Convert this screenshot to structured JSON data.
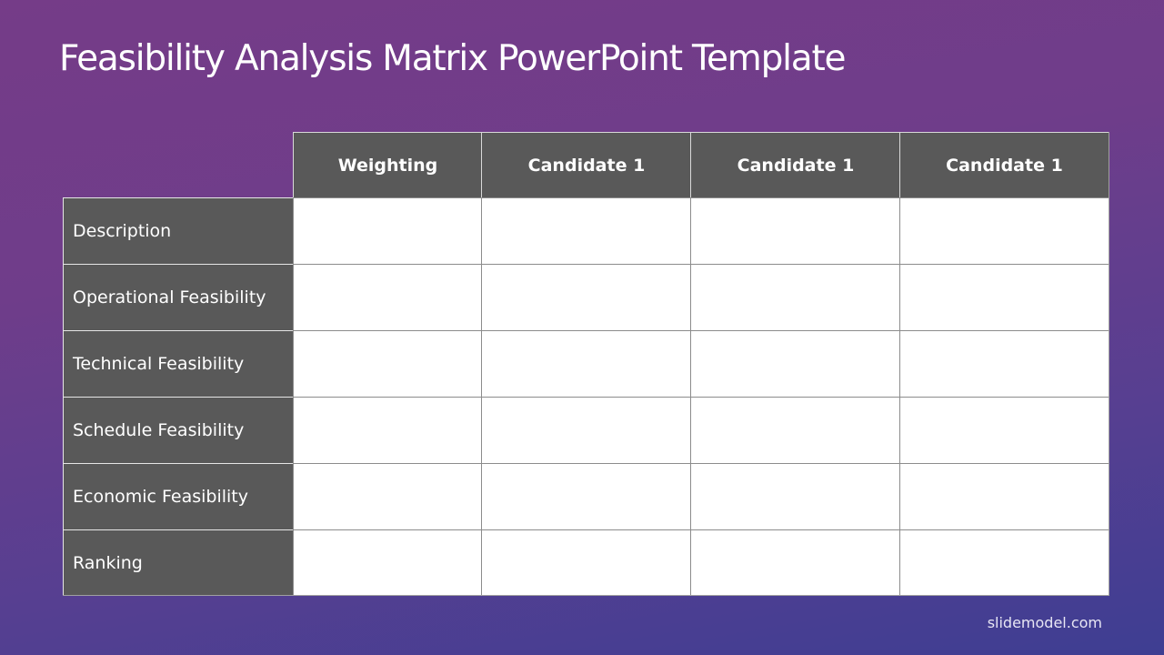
{
  "slide": {
    "title": "Feasibility Analysis Matrix PowerPoint Template",
    "footer": "slidemodel.com"
  },
  "table": {
    "columns": [
      "Weighting",
      "Candidate 1",
      "Candidate 1",
      "Candidate 1"
    ],
    "rows": [
      {
        "label": "Description",
        "cells": [
          "",
          "",
          "",
          ""
        ]
      },
      {
        "label": "Operational Feasibility",
        "cells": [
          "",
          "",
          "",
          ""
        ]
      },
      {
        "label": "Technical Feasibility",
        "cells": [
          "",
          "",
          "",
          ""
        ]
      },
      {
        "label": "Schedule Feasibility",
        "cells": [
          "",
          "",
          "",
          ""
        ]
      },
      {
        "label": "Economic Feasibility",
        "cells": [
          "",
          "",
          "",
          ""
        ]
      },
      {
        "label": "Ranking",
        "cells": [
          "",
          "",
          "",
          ""
        ]
      }
    ]
  },
  "colors": {
    "header_fill": "#595959",
    "cell_fill": "#ffffff",
    "background_top": "#753c88",
    "background_bottom": "#3e3e92"
  }
}
